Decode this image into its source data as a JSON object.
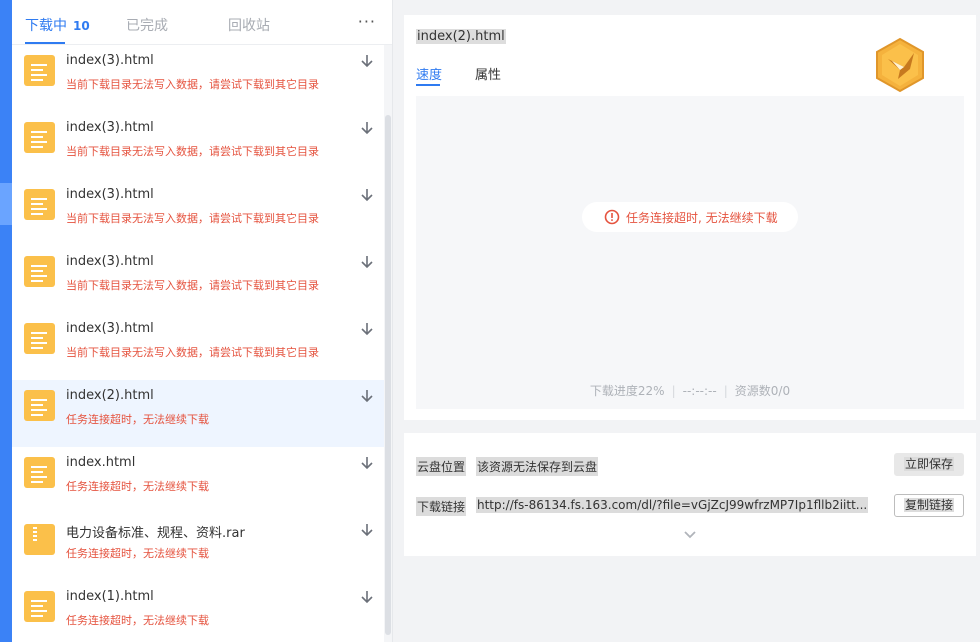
{
  "tabs": {
    "downloading_label": "下载中",
    "downloading_count": "10",
    "completed_label": "已完成",
    "recycle_label": "回收站",
    "more_label": "···"
  },
  "downloads": [
    {
      "name": "index(3).html",
      "status": "当前下载目录无法写入数据，请尝试下载到其它目录",
      "icon": "document-icon",
      "selected": false
    },
    {
      "name": "index(3).html",
      "status": "当前下载目录无法写入数据，请尝试下载到其它目录",
      "icon": "document-icon",
      "selected": false
    },
    {
      "name": "index(3).html",
      "status": "当前下载目录无法写入数据，请尝试下载到其它目录",
      "icon": "document-icon",
      "selected": false
    },
    {
      "name": "index(3).html",
      "status": "当前下载目录无法写入数据，请尝试下载到其它目录",
      "icon": "document-icon",
      "selected": false
    },
    {
      "name": "index(3).html",
      "status": "当前下载目录无法写入数据，请尝试下载到其它目录",
      "icon": "document-icon",
      "selected": false
    },
    {
      "name": "index(2).html",
      "status": "任务连接超时，无法继续下载",
      "icon": "document-icon",
      "selected": true
    },
    {
      "name": "index.html",
      "status": "任务连接超时，无法继续下载",
      "icon": "document-icon",
      "selected": false
    },
    {
      "name": "电力设备标准、规程、资料.rar",
      "status": "任务连接超时，无法继续下载",
      "icon": "archive-icon",
      "selected": false
    },
    {
      "name": "index(1).html",
      "status": "任务连接超时，无法继续下载",
      "icon": "document-icon",
      "selected": false
    }
  ],
  "detail": {
    "file_name": "index(2).html",
    "tab_speed": "速度",
    "tab_properties": "属性",
    "error_message": "任务连接超时, 无法继续下载",
    "progress_text": "下载进度22%",
    "speed_text": "--:--:--",
    "sources_text": "资源数0/0"
  },
  "cloud": {
    "location_label": "云盘位置",
    "location_value": "该资源无法保存到云盘",
    "save_button": "立即保存",
    "link_label": "下载链接",
    "link_value": "http://fs-86134.fs.163.com/dl/?file=vGjZcJ99wfrzMP7Ip1fllb2iitt...",
    "copy_button": "复制链接"
  },
  "colors": {
    "accent": "#2f7bf1",
    "error": "#e5533f",
    "file_icon": "#fbc04a",
    "selected_row": "#eef5ff"
  }
}
